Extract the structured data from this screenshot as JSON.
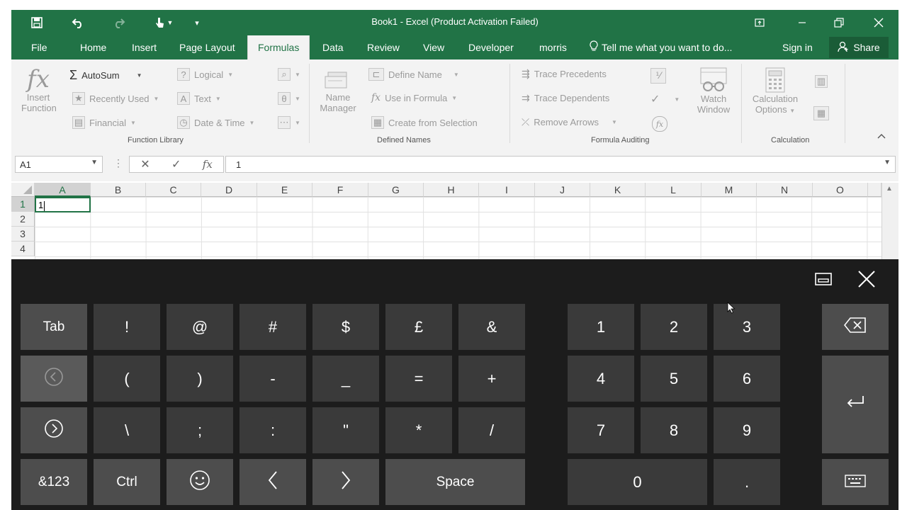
{
  "window": {
    "title": "Book1 - Excel (Product Activation Failed)",
    "qa_icons": [
      "save-icon",
      "undo-icon",
      "redo-icon",
      "touch-mode-icon",
      "customize-icon"
    ]
  },
  "menu": {
    "tabs": [
      "File",
      "Home",
      "Insert",
      "Page Layout",
      "Formulas",
      "Data",
      "Review",
      "View",
      "Developer",
      "morris"
    ],
    "active_tab": "Formulas",
    "tell_me": "Tell me what you want to do...",
    "sign_in": "Sign in",
    "share": "Share"
  },
  "ribbon": {
    "function_library": {
      "insert_function": [
        "Insert",
        "Function"
      ],
      "autosum": "AutoSum",
      "recently_used": "Recently Used",
      "financial": "Financial",
      "logical": "Logical",
      "text": "Text",
      "date_time": "Date & Time",
      "label": "Function Library"
    },
    "defined_names": {
      "name_manager": [
        "Name",
        "Manager"
      ],
      "define_name": "Define Name",
      "use_in_formula": "Use in Formula",
      "create_from_selection": "Create from Selection",
      "label": "Defined Names"
    },
    "formula_auditing": {
      "trace_precedents": "Trace Precedents",
      "trace_dependents": "Trace Dependents",
      "remove_arrows": "Remove Arrows",
      "watch_window": [
        "Watch",
        "Window"
      ],
      "label": "Formula Auditing"
    },
    "calculation": {
      "calc_options": [
        "Calculation",
        "Options"
      ],
      "label": "Calculation"
    }
  },
  "formula_bar": {
    "name_box": "A1",
    "value": "1"
  },
  "sheet": {
    "columns": [
      "A",
      "B",
      "C",
      "D",
      "E",
      "F",
      "G",
      "H",
      "I",
      "J",
      "K",
      "L",
      "M",
      "N",
      "O"
    ],
    "rows": [
      "1",
      "2",
      "3",
      "4"
    ],
    "active_cell_value": "1"
  },
  "keyboard": {
    "row1": [
      "Tab",
      "!",
      "@",
      "#",
      "$",
      "£",
      "&"
    ],
    "row2": [
      "(",
      ")",
      "-",
      "_",
      "=",
      "+"
    ],
    "row3": [
      "\\",
      ";",
      ":",
      "\"",
      "*",
      "/"
    ],
    "row4": [
      "&123",
      "Ctrl",
      "<",
      ">",
      "Space"
    ],
    "numpad": [
      "1",
      "2",
      "3",
      "4",
      "5",
      "6",
      "7",
      "8",
      "9",
      "0",
      "."
    ]
  }
}
